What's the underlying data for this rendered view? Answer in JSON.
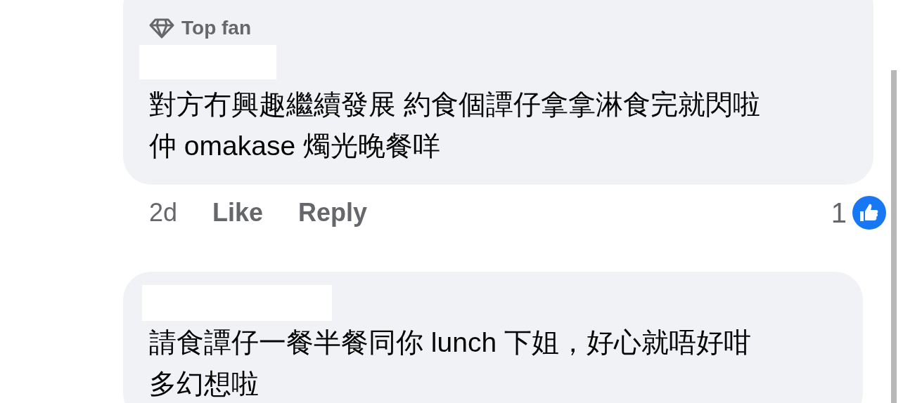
{
  "comments": [
    {
      "badge": "Top fan",
      "text": "對方冇興趣繼續發展 約食個譚仔拿拿淋食完就閃啦仲 omakase 燭光晚餐咩",
      "time": "2d",
      "actions": [
        "Like",
        "Reply"
      ],
      "reaction_count": "1"
    },
    {
      "text": "請食譚仔一餐半餐同你 lunch 下姐，好心就唔好咁多幻想啦"
    }
  ]
}
